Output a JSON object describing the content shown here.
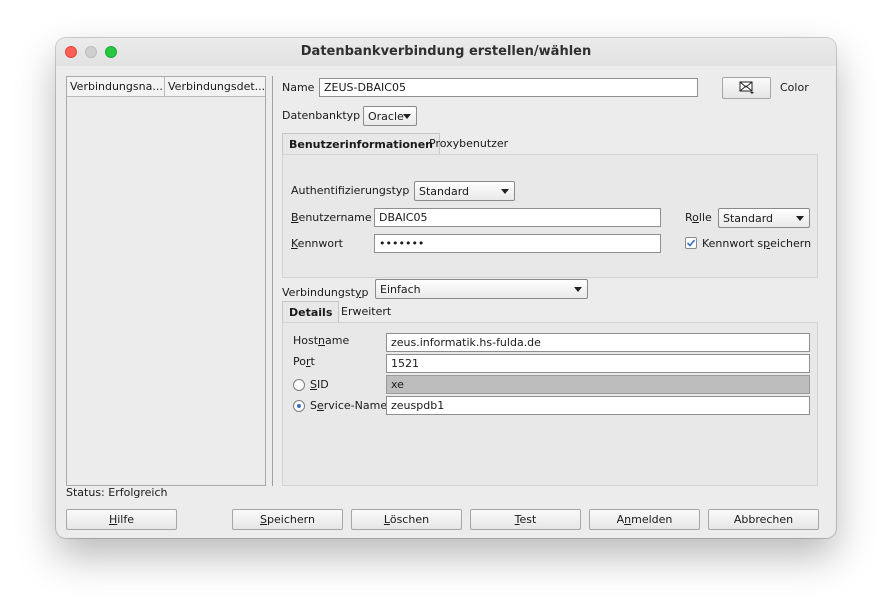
{
  "window": {
    "title": "Datenbankverbindung erstellen/wählen"
  },
  "table": {
    "columns": [
      "Verbindungsna...",
      "Verbindungsdet..."
    ]
  },
  "name_label": "Name",
  "name_value": "ZEUS-DBAIC05",
  "color_label": "Color",
  "dbtype_label": "Datenbanktyp",
  "dbtype_value": "Oracle",
  "tabs_top": [
    "Benutzerinformationen",
    "Proxybenutzer"
  ],
  "auth": {
    "label": "Authentifizierungstyp",
    "value": "Standard"
  },
  "user": {
    "label": "Benutzername",
    "value": "DBAIC05"
  },
  "role": {
    "label": "Rolle",
    "value": "Standard"
  },
  "password": {
    "label": "Kennwort",
    "value": "•••••••"
  },
  "save_password": {
    "label": "Kennwort speichern",
    "checked": true
  },
  "conntype": {
    "label": "Verbindungstyp",
    "value": "Einfach"
  },
  "tabs_bottom": [
    "Details",
    "Erweitert"
  ],
  "host": {
    "label": "Hostname",
    "value": "zeus.informatik.hs-fulda.de"
  },
  "port": {
    "label": "Port",
    "value": "1521"
  },
  "sid": {
    "label": "SID",
    "value": "xe"
  },
  "service": {
    "label": "Service-Name",
    "value": "zeuspdb1"
  },
  "status": "Status: Erfolgreich",
  "buttons": {
    "help": "Hilfe",
    "save": "Speichern",
    "delete": "Löschen",
    "test": "Test",
    "login": "Anmelden",
    "cancel": "Abbrechen"
  },
  "colors": {
    "accent": "#3a6fc6",
    "close": "#fe5f57",
    "zoom": "#28c840"
  },
  "icons": {
    "color_button": "envelope-icon"
  }
}
